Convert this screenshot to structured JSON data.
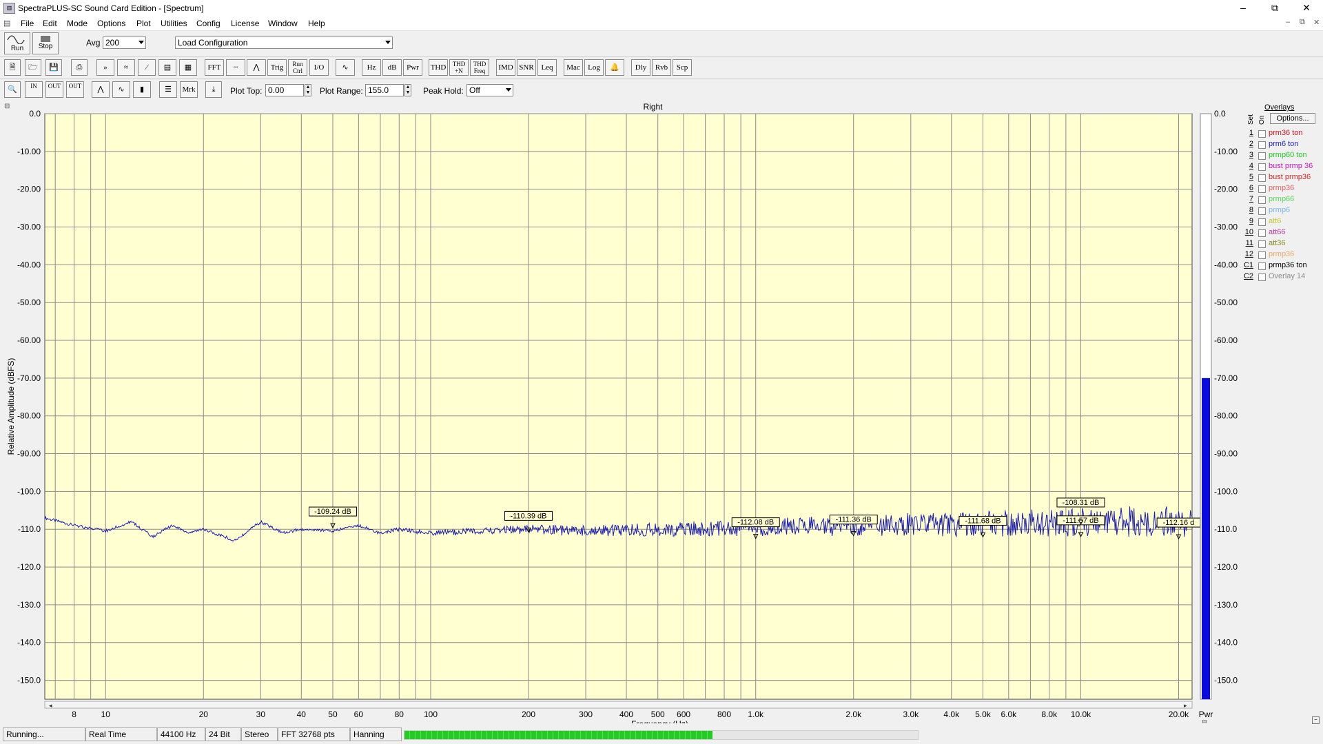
{
  "window": {
    "title": "SpectraPLUS-SC Sound Card Edition - [Spectrum]",
    "icon": "app-icon"
  },
  "menu": [
    "File",
    "Edit",
    "Mode",
    "Options",
    "Plot",
    "Utilities",
    "Config",
    "License",
    "Window",
    "Help"
  ],
  "toolbar1": {
    "run_label": "Run",
    "stop_label": "Stop",
    "avg_label": "Avg",
    "avg_value": "200",
    "config_value": "Load Configuration"
  },
  "toolbar2": {
    "buttons": [
      "new",
      "open",
      "save",
      "print",
      "FFT-run",
      "FFT-avg",
      "slope",
      "waterfall",
      "spectrogram",
      "FFT",
      "time",
      "phase",
      "Trig",
      "Run Ctrl",
      "I/O",
      "generator",
      "Hz",
      "dB",
      "Pwr",
      "THD",
      "THD +N",
      "THD Freq",
      "IMD",
      "SNR",
      "Leq",
      "Mac",
      "Log",
      "bell",
      "Dly",
      "Rvb",
      "Scp"
    ]
  },
  "toolbar3": {
    "plot_top_label": "Plot Top:",
    "plot_top_value": "0.00",
    "plot_range_label": "Plot Range:",
    "plot_range_value": "155.0",
    "peak_hold_label": "Peak Hold:",
    "peak_hold_value": "Off",
    "zoom_in_label": "IN",
    "zoom_out_label": "OUT",
    "mrk_label": "Mrk"
  },
  "overlays": {
    "title": "Overlays",
    "options_label": "Options...",
    "set_header": "Set",
    "on_header": "On",
    "items": [
      {
        "num": "1",
        "name": "prm36 ton",
        "color": "#d4141e"
      },
      {
        "num": "2",
        "name": "prm6 ton",
        "color": "#1e1ec8"
      },
      {
        "num": "3",
        "name": "prmp60 ton",
        "color": "#22c822"
      },
      {
        "num": "4",
        "name": "bust prmp 36",
        "color": "#c814c8"
      },
      {
        "num": "5",
        "name": "bust prmp36",
        "color": "#d42828"
      },
      {
        "num": "6",
        "name": "prmp36",
        "color": "#e86060"
      },
      {
        "num": "7",
        "name": "prmp66",
        "color": "#58d858"
      },
      {
        "num": "8",
        "name": "prmp6",
        "color": "#7ab8e8"
      },
      {
        "num": "9",
        "name": "att6",
        "color": "#c8c832"
      },
      {
        "num": "10",
        "name": "att66",
        "color": "#b83c9c"
      },
      {
        "num": "11",
        "name": "att36",
        "color": "#888820"
      },
      {
        "num": "12",
        "name": "prmp36",
        "color": "#e8a868"
      },
      {
        "num": "C1",
        "name": "prmp36 ton",
        "color": "#000000"
      },
      {
        "num": "C2",
        "name": "Overlay 14",
        "color": "#8c8c8c"
      }
    ]
  },
  "chart_data": {
    "type": "line",
    "title": "Right",
    "xlabel": "Frequency (Hz)",
    "ylabel": "Relative Amplitude (dBFS)",
    "x_scale": "log",
    "xlim": [
      6.5,
      22000
    ],
    "ylim": [
      -155,
      0
    ],
    "grid": true,
    "y_ticks": [
      "0.0",
      "-10.00",
      "-20.00",
      "-30.00",
      "-40.00",
      "-50.00",
      "-60.00",
      "-70.00",
      "-80.00",
      "-90.00",
      "-100.0",
      "-110.0",
      "-120.0",
      "-130.0",
      "-140.0",
      "-150.0"
    ],
    "x_ticks": [
      {
        "v": 8,
        "label": "8"
      },
      {
        "v": 10,
        "label": "10"
      },
      {
        "v": 20,
        "label": "20"
      },
      {
        "v": 30,
        "label": "30"
      },
      {
        "v": 40,
        "label": "40"
      },
      {
        "v": 50,
        "label": "50"
      },
      {
        "v": 60,
        "label": "60"
      },
      {
        "v": 80,
        "label": "80"
      },
      {
        "v": 100,
        "label": "100"
      },
      {
        "v": 200,
        "label": "200"
      },
      {
        "v": 300,
        "label": "300"
      },
      {
        "v": 400,
        "label": "400"
      },
      {
        "v": 500,
        "label": "500"
      },
      {
        "v": 600,
        "label": "600"
      },
      {
        "v": 800,
        "label": "800"
      },
      {
        "v": 1000,
        "label": "1.0k"
      },
      {
        "v": 2000,
        "label": "2.0k"
      },
      {
        "v": 3000,
        "label": "3.0k"
      },
      {
        "v": 4000,
        "label": "4.0k"
      },
      {
        "v": 5000,
        "label": "5.0k"
      },
      {
        "v": 6000,
        "label": "6.0k"
      },
      {
        "v": 8000,
        "label": "8.0k"
      },
      {
        "v": 10000,
        "label": "10.0k"
      },
      {
        "v": 20000,
        "label": "20.0k"
      }
    ],
    "series": [
      {
        "color": "#1a1ab4",
        "x": [
          6.5,
          8,
          10,
          12,
          14,
          16,
          18,
          20,
          25,
          30,
          35,
          40,
          50,
          60,
          70,
          80,
          100,
          150,
          200,
          300,
          500,
          1000,
          2000,
          5000,
          10000,
          20000,
          22000
        ],
        "y": [
          -107,
          -109,
          -110.5,
          -108,
          -112,
          -109,
          -111,
          -110,
          -113,
          -108,
          -111,
          -110,
          -110.5,
          -109,
          -111,
          -110,
          -111,
          -110.5,
          -110,
          -110.5,
          -110,
          -109.5,
          -109,
          -108.5,
          -108,
          -108,
          -108
        ]
      }
    ],
    "markers": [
      {
        "x": 50,
        "y": -109.24,
        "label": "-109.24 dB"
      },
      {
        "x": 200,
        "y": -110.39,
        "label": "-110.39 dB"
      },
      {
        "x": 1000,
        "y": -112.08,
        "label": "-112.08 dB"
      },
      {
        "x": 2000,
        "y": -111.36,
        "label": "-111.36 dB"
      },
      {
        "x": 5000,
        "y": -111.68,
        "label": "-111.68 dB"
      },
      {
        "x": 10000,
        "y": -111.57,
        "label": "-111.57 dB"
      },
      {
        "x": 10000,
        "y": -108.31,
        "label": "-108.31 dB"
      },
      {
        "x": 20000,
        "y": -112.16,
        "label": "-112.16 d"
      }
    ],
    "power_meter": {
      "label": "Pwr",
      "level_db": -70,
      "color": "#0a0adc"
    }
  },
  "status": {
    "state": "Running...",
    "mode": "Real Time",
    "rate": "44100 Hz",
    "bits": "24 Bit",
    "channels": "Stereo",
    "fft": "FFT 32768 pts",
    "window": "Hanning",
    "progress": 0.6
  }
}
